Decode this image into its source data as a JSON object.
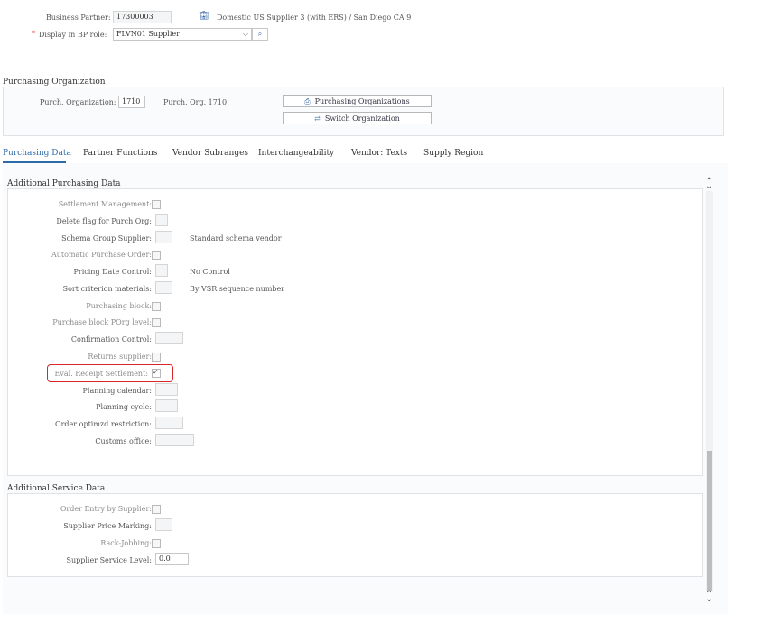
{
  "header": {
    "business_partner_label": "Business Partner:",
    "business_partner_value": "17300003",
    "business_partner_desc": "Domestic US Supplier 3 (with ERS) / San Diego CA 9",
    "required_marker": "*",
    "bp_role_label": "Display in BP role:",
    "bp_role_value": "FLVN01 Supplier"
  },
  "purch_org": {
    "section_title": "Purchasing Organization",
    "label": "Purch. Organization:",
    "value": "1710",
    "desc": "Purch. Org. 1710",
    "btn_orgs": "Purchasing Organizations",
    "btn_switch": "Switch Organization"
  },
  "tabs": [
    {
      "label": "Purchasing Data"
    },
    {
      "label": "Partner Functions"
    },
    {
      "label": "Vendor Subranges"
    },
    {
      "label": "Interchangeability"
    },
    {
      "label": "Vendor: Texts"
    },
    {
      "label": "Supply Region"
    }
  ],
  "additional_purchasing": {
    "title": "Additional Purchasing Data",
    "rows": [
      {
        "label": "Settlement Management:",
        "value": "",
        "desc": ""
      },
      {
        "label": "Delete flag for Purch Org:",
        "value": "",
        "desc": ""
      },
      {
        "label": "Schema Group Supplier:",
        "value": "",
        "desc": "Standard schema vendor"
      },
      {
        "label": "Automatic Purchase Order:",
        "value": "",
        "desc": ""
      },
      {
        "label": "Pricing Date Control:",
        "value": "",
        "desc": "No Control"
      },
      {
        "label": "Sort criterion materials:",
        "value": "",
        "desc": "By VSR sequence number"
      },
      {
        "label": "Purchasing block:",
        "value": "",
        "desc": ""
      },
      {
        "label": "Purchase block POrg level:",
        "value": "",
        "desc": ""
      },
      {
        "label": "Confirmation Control:",
        "value": "",
        "desc": ""
      },
      {
        "label": "Returns supplier:",
        "value": "",
        "desc": ""
      },
      {
        "label": "Eval. Receipt Settlement:",
        "value": "checked",
        "desc": ""
      },
      {
        "label": "Planning calendar:",
        "value": "",
        "desc": ""
      },
      {
        "label": "Planning cycle:",
        "value": "",
        "desc": ""
      },
      {
        "label": "Order optimzd restriction:",
        "value": "",
        "desc": ""
      },
      {
        "label": "Customs office:",
        "value": "",
        "desc": ""
      }
    ]
  },
  "additional_service": {
    "title": "Additional Service Data",
    "rows": [
      {
        "label": "Order Entry by Supplier:",
        "value": ""
      },
      {
        "label": "Supplier Price Marking:",
        "value": ""
      },
      {
        "label": "Rack-Jobbing:",
        "value": ""
      },
      {
        "label": "Supplier Service Level:",
        "value": "0.0"
      }
    ]
  },
  "icons": {
    "bp_icon": "building-icon",
    "dropdown": "chevron-down-icon",
    "search": "search-icon",
    "orgs": "organization-icon",
    "switch": "switch-icon",
    "check": "✓",
    "scroll_up": "⌃",
    "scroll_down": "⌄"
  },
  "colors": {
    "accent": "#2d6aa8",
    "highlight": "#d9262b"
  }
}
